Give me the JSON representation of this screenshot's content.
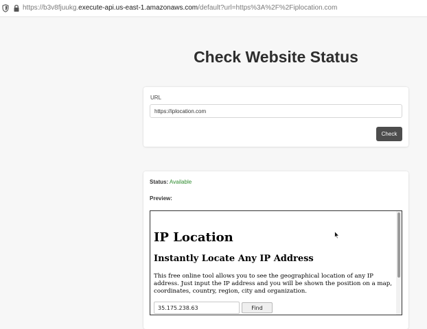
{
  "browser": {
    "url_prefix": "https://b3v8fjuukg.",
    "url_host": "execute-api.us-east-1.amazonaws.com",
    "url_suffix": "/default?url=https%3A%2F%2Fiplocation.com"
  },
  "page": {
    "title": "Check Website Status"
  },
  "form": {
    "url_label": "URL",
    "url_value": "https://iplocation.com",
    "check_label": "Check"
  },
  "result": {
    "status_label": "Status:",
    "status_value": "Available",
    "status_color": "#2e8b2e",
    "preview_label": "Preview:"
  },
  "preview": {
    "heading": "IP Location",
    "subheading": "Instantly Locate Any IP Address",
    "description": "This free online tool allows you to see the geographical location of any IP address. Just input the IP address and you will be shown the position on a map, coordinates, country, region, city and organization.",
    "ip_value": "35.175.238.63",
    "find_label": "Find"
  },
  "icons": {
    "shield": "shield-icon",
    "lock": "lock-icon",
    "cursor": "mouse-cursor-icon"
  }
}
